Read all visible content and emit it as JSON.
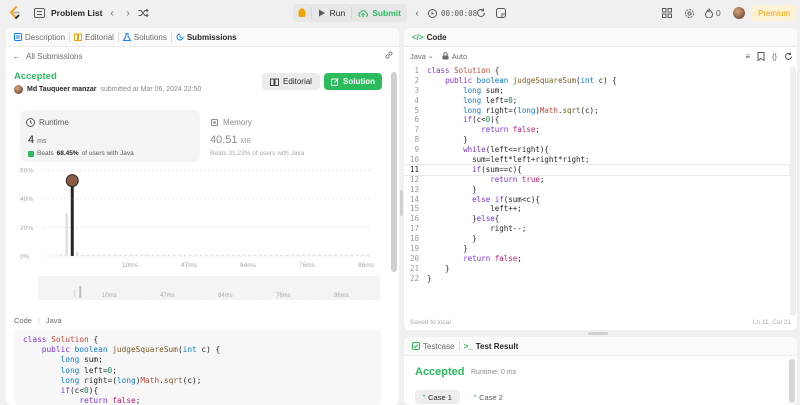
{
  "topbar": {
    "problem_list": "Problem List",
    "run": "Run",
    "submit": "Submit",
    "timer": "00:00:08",
    "streak": "0",
    "premium": "Premium"
  },
  "left_tabs": [
    {
      "label": "Description",
      "icon": "description-icon"
    },
    {
      "label": "Editorial",
      "icon": "editorial-icon"
    },
    {
      "label": "Solutions",
      "icon": "solutions-icon"
    },
    {
      "label": "Submissions",
      "icon": "submissions-icon",
      "active": true
    }
  ],
  "submission": {
    "back_label": "All Submissions",
    "status": "Accepted",
    "user": "Md Tauqueer manzar",
    "submitted_text": "submitted at Mar 06, 2024 22:50",
    "editorial_btn": "Editorial",
    "solution_btn": "Solution",
    "runtime_label": "Runtime",
    "runtime_value": "4",
    "runtime_unit": "ms",
    "runtime_beats": "Beats 68.45% of users with Java",
    "runtime_beats_prefix": "Beats",
    "runtime_beats_pct": "68.45%",
    "runtime_beats_suffix": "of users with Java",
    "memory_label": "Memory",
    "memory_value": "40.51",
    "memory_unit": "MB",
    "memory_beats": "Beats 31.23% of users with Java"
  },
  "chart_data": {
    "type": "bar",
    "y_ticks": [
      "60%",
      "40%",
      "20%",
      "0%"
    ],
    "ylim": [
      0,
      60
    ],
    "x_ticks": [
      "10ms",
      "47ms",
      "84ms",
      "76ms",
      "86ms"
    ],
    "mini_x_ticks": [
      "10ms",
      "47ms",
      "84ms",
      "76ms",
      "86ms"
    ],
    "highlight_value": 40,
    "values": [
      1,
      30,
      40,
      3,
      1,
      1,
      1,
      1,
      1,
      1,
      1,
      1,
      1,
      1,
      1,
      1,
      1,
      1,
      1,
      1,
      1,
      1,
      1,
      1,
      1,
      1,
      1,
      1,
      1,
      1,
      1,
      1,
      1,
      1,
      1,
      1,
      1,
      1,
      1,
      1,
      1,
      1,
      1,
      1,
      1,
      1,
      1,
      1,
      1,
      1,
      1,
      1,
      1,
      1,
      1,
      1,
      1,
      1
    ],
    "highlight_index": 2
  },
  "code_preview": {
    "label": "Code",
    "lang": "Java"
  },
  "editor": {
    "tab_label": "Code",
    "lang": "Java",
    "auto": "Auto",
    "saved": "Saved to local",
    "cursor": "Ln 11, Col 21"
  },
  "code_lines": [
    "class Solution {",
    "    public boolean judgeSquareSum(int c) {",
    "        long sum;",
    "        long left=0;",
    "        long right=(long)Math.sqrt(c);",
    "        if(c<0){",
    "            return false;",
    "        }",
    "        while(left<=right){",
    "          sum=left*left+right*right;",
    "          if(sum==c){",
    "              return true;",
    "          }",
    "          else if(sum<c){",
    "              left++;",
    "          }else{",
    "              right--;",
    "          }",
    "        }",
    "        return false;",
    "    }",
    "}"
  ],
  "bottom": {
    "testcase_tab": "Testcase",
    "result_tab": "Test Result",
    "status": "Accepted",
    "runtime": "Runtime: 0 ms",
    "case1": "Case 1",
    "case2": "Case 2"
  }
}
